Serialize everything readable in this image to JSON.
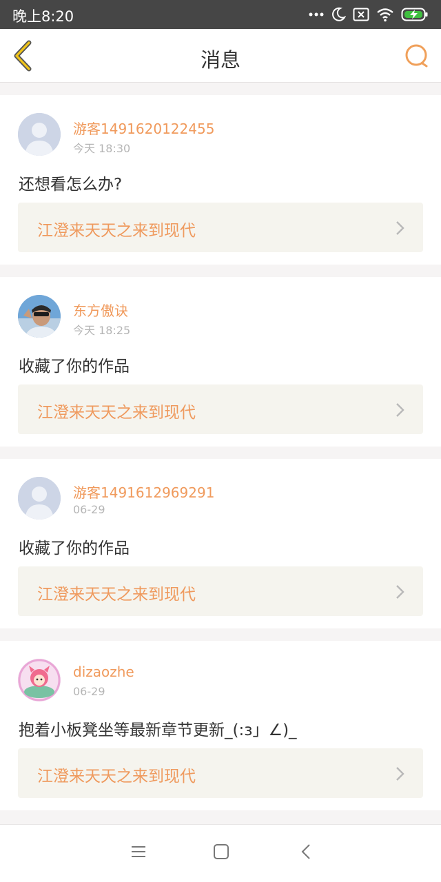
{
  "status_bar": {
    "time": "晚上8:20",
    "icons": [
      "more-dots-icon",
      "moon-icon",
      "notification-x-icon",
      "wifi-icon",
      "battery-charging-icon"
    ],
    "battery_color": "#3fbf3f"
  },
  "header": {
    "title": "消息",
    "back_icon": "chevron-left-icon",
    "search_icon": "search-icon",
    "accent_color": "#f0a05a"
  },
  "messages": [
    {
      "username": "游客1491620122455",
      "time": "今天 18:30",
      "text": "还想看怎么办?",
      "work_title": "江澄来天天之来到现代",
      "avatar": "default-avatar"
    },
    {
      "username": "东方傲诀",
      "time": "今天 18:25",
      "text": "收藏了你的作品",
      "work_title": "江澄来天天之来到现代",
      "avatar": "photo-avatar"
    },
    {
      "username": "游客1491612969291",
      "time": "06-29",
      "text": "收藏了你的作品",
      "work_title": "江澄来天天之来到现代",
      "avatar": "default-avatar"
    },
    {
      "username": "dizaozhe",
      "time": "06-29",
      "text": "抱着小板凳坐等最新章节更新_(:з」∠)_",
      "work_title": "江澄来天天之来到现代",
      "avatar": "cartoon-avatar"
    }
  ],
  "nav_bar": {
    "icons": [
      "menu-icon",
      "home-square-icon",
      "back-arrow-icon"
    ]
  },
  "colors": {
    "username": "#f09a5c",
    "work_title": "#ef9a5e",
    "time": "#b5b5b5",
    "background": "#f6f4f4"
  }
}
